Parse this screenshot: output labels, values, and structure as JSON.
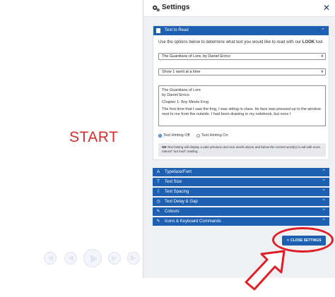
{
  "start_label": "START",
  "colors": {
    "accent": "#1d5fb0",
    "annotation": "#e01e25",
    "start": "#d42b2b"
  },
  "player": {
    "icons": [
      "skip-back-icon",
      "prev-icon",
      "play-icon",
      "next-icon",
      "skip-forward-icon"
    ]
  },
  "settings": {
    "title": "Settings",
    "close_glyph": "✕",
    "text_to_read": {
      "header": "Text to Read",
      "intro_prefix": "Use the options below to determine what text you would like to read with our ",
      "intro_look": "LOOK",
      "intro_suffix": " tool.",
      "book_select": "The Guardians of Lore, by Daniel Errico",
      "mode_select": "Show 1 word at a time",
      "text_lines": [
        "The Guardians of Lore",
        "by Daniel Errico",
        "Chapter 1: Boy Meets Frog",
        "The first time that I saw the frog, I was sitting in class. Its face was pressed up to the window next to me from the outside. I had been drawing in my notebook, but once I"
      ],
      "radio_off": "Text Hinting Off",
      "radio_on": "Text Hinting On",
      "note_label": "NB",
      "note_text": "Text hinting will display a pale previous and next words above and below the current word(s) to aid with more natural \"out loud\" reading."
    },
    "sections": [
      {
        "label": "Typeface/Font",
        "icon": "A"
      },
      {
        "label": "Text Size",
        "icon": "T"
      },
      {
        "label": "Text Spacing",
        "icon": "I"
      },
      {
        "label": "Text Delay & Gap",
        "icon": "◷"
      },
      {
        "label": "Colours",
        "icon": "✎"
      },
      {
        "label": "Icons & Keyboard Commands",
        "icon": "✎"
      }
    ],
    "close_button": "✕  CLOSE SETTINGS"
  }
}
